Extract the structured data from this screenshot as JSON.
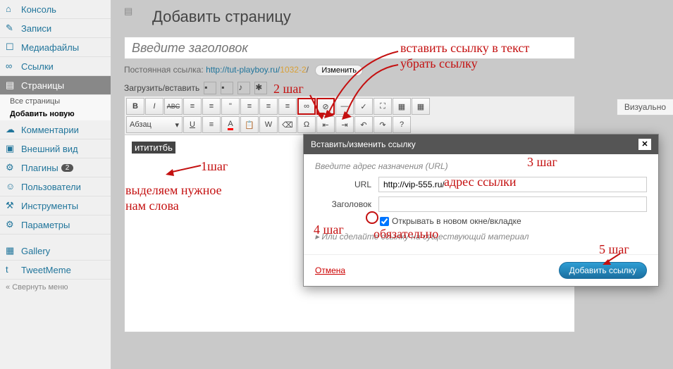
{
  "sidebar": {
    "items": [
      {
        "label": "Консоль",
        "icon": "dashboard"
      },
      {
        "label": "Записи",
        "icon": "pin"
      },
      {
        "label": "Медиафайлы",
        "icon": "media"
      },
      {
        "label": "Ссылки",
        "icon": "link"
      },
      {
        "label": "Страницы",
        "icon": "page",
        "active": true
      },
      {
        "label": "Комментарии",
        "icon": "comment"
      },
      {
        "label": "Внешний вид",
        "icon": "appearance"
      },
      {
        "label": "Плагины",
        "icon": "plugin",
        "badge": "2"
      },
      {
        "label": "Пользователи",
        "icon": "users"
      },
      {
        "label": "Инструменты",
        "icon": "tools"
      },
      {
        "label": "Параметры",
        "icon": "settings"
      },
      {
        "label": "Gallery",
        "icon": "gallery"
      },
      {
        "label": "TweetMeme",
        "icon": "tweet"
      }
    ],
    "sub_all": "Все страницы",
    "sub_add": "Добавить новую",
    "collapse": "Свернуть меню"
  },
  "header": {
    "title": "Добавить страницу"
  },
  "title_placeholder": "Введите заголовок",
  "permalink": {
    "label": "Постоянная ссылка:",
    "url": "http://tut-playboy.ru/",
    "slug": "1032-2",
    "edit": "Изменить"
  },
  "upload_label": "Загрузить/вставить",
  "tab_visual": "Визуально",
  "toolbar": {
    "format_sel": "Абзац",
    "b": "B",
    "i": "I",
    "abc": "ABC"
  },
  "editor": {
    "selected_text": "итититбь"
  },
  "modal": {
    "title": "Вставить/изменить ссылку",
    "hint": "Введите адрес назначения (URL)",
    "url_label": "URL",
    "url_value": "http://vip-555.ru/",
    "title_label": "Заголовок",
    "title_value": "",
    "checkbox_label": "Открывать в новом окне/вкладке",
    "checkbox_checked": true,
    "existing": "Или сделайте ссылку на существующий материал",
    "cancel": "Отмена",
    "submit": "Добавить ссылку"
  },
  "annotations": {
    "step1": "1шаг",
    "step1_text1": "выделяем нужное",
    "step1_text2": "нам слова",
    "step2": "2 шаг",
    "insert_link": "вставить ссылку в текст",
    "remove_link": "убрать ссылку",
    "step3": "3 шаг",
    "addr": "адрес ссылки",
    "step4": "4 шаг",
    "required": "обязательно",
    "step5": "5 шаг"
  }
}
